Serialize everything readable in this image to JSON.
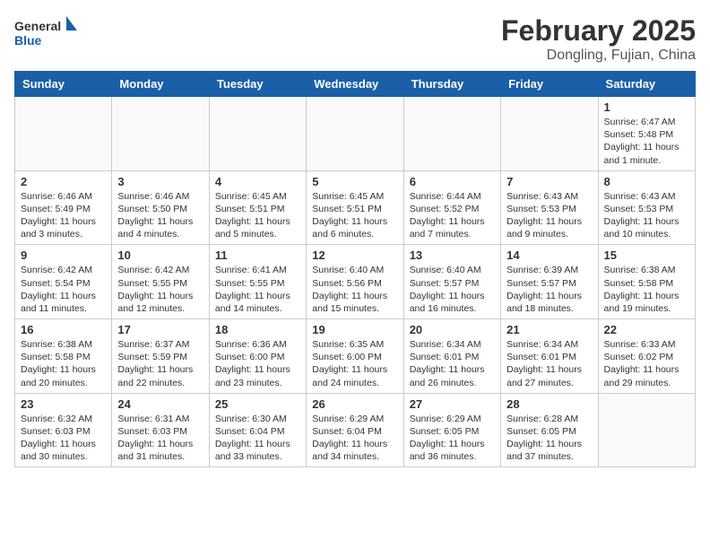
{
  "header": {
    "logo_general": "General",
    "logo_blue": "Blue",
    "title": "February 2025",
    "subtitle": "Dongling, Fujian, China"
  },
  "days_of_week": [
    "Sunday",
    "Monday",
    "Tuesday",
    "Wednesday",
    "Thursday",
    "Friday",
    "Saturday"
  ],
  "weeks": [
    [
      {
        "day": "",
        "info": ""
      },
      {
        "day": "",
        "info": ""
      },
      {
        "day": "",
        "info": ""
      },
      {
        "day": "",
        "info": ""
      },
      {
        "day": "",
        "info": ""
      },
      {
        "day": "",
        "info": ""
      },
      {
        "day": "1",
        "info": "Sunrise: 6:47 AM\nSunset: 5:48 PM\nDaylight: 11 hours\nand 1 minute."
      }
    ],
    [
      {
        "day": "2",
        "info": "Sunrise: 6:46 AM\nSunset: 5:49 PM\nDaylight: 11 hours\nand 3 minutes."
      },
      {
        "day": "3",
        "info": "Sunrise: 6:46 AM\nSunset: 5:50 PM\nDaylight: 11 hours\nand 4 minutes."
      },
      {
        "day": "4",
        "info": "Sunrise: 6:45 AM\nSunset: 5:51 PM\nDaylight: 11 hours\nand 5 minutes."
      },
      {
        "day": "5",
        "info": "Sunrise: 6:45 AM\nSunset: 5:51 PM\nDaylight: 11 hours\nand 6 minutes."
      },
      {
        "day": "6",
        "info": "Sunrise: 6:44 AM\nSunset: 5:52 PM\nDaylight: 11 hours\nand 7 minutes."
      },
      {
        "day": "7",
        "info": "Sunrise: 6:43 AM\nSunset: 5:53 PM\nDaylight: 11 hours\nand 9 minutes."
      },
      {
        "day": "8",
        "info": "Sunrise: 6:43 AM\nSunset: 5:53 PM\nDaylight: 11 hours\nand 10 minutes."
      }
    ],
    [
      {
        "day": "9",
        "info": "Sunrise: 6:42 AM\nSunset: 5:54 PM\nDaylight: 11 hours\nand 11 minutes."
      },
      {
        "day": "10",
        "info": "Sunrise: 6:42 AM\nSunset: 5:55 PM\nDaylight: 11 hours\nand 12 minutes."
      },
      {
        "day": "11",
        "info": "Sunrise: 6:41 AM\nSunset: 5:55 PM\nDaylight: 11 hours\nand 14 minutes."
      },
      {
        "day": "12",
        "info": "Sunrise: 6:40 AM\nSunset: 5:56 PM\nDaylight: 11 hours\nand 15 minutes."
      },
      {
        "day": "13",
        "info": "Sunrise: 6:40 AM\nSunset: 5:57 PM\nDaylight: 11 hours\nand 16 minutes."
      },
      {
        "day": "14",
        "info": "Sunrise: 6:39 AM\nSunset: 5:57 PM\nDaylight: 11 hours\nand 18 minutes."
      },
      {
        "day": "15",
        "info": "Sunrise: 6:38 AM\nSunset: 5:58 PM\nDaylight: 11 hours\nand 19 minutes."
      }
    ],
    [
      {
        "day": "16",
        "info": "Sunrise: 6:38 AM\nSunset: 5:58 PM\nDaylight: 11 hours\nand 20 minutes."
      },
      {
        "day": "17",
        "info": "Sunrise: 6:37 AM\nSunset: 5:59 PM\nDaylight: 11 hours\nand 22 minutes."
      },
      {
        "day": "18",
        "info": "Sunrise: 6:36 AM\nSunset: 6:00 PM\nDaylight: 11 hours\nand 23 minutes."
      },
      {
        "day": "19",
        "info": "Sunrise: 6:35 AM\nSunset: 6:00 PM\nDaylight: 11 hours\nand 24 minutes."
      },
      {
        "day": "20",
        "info": "Sunrise: 6:34 AM\nSunset: 6:01 PM\nDaylight: 11 hours\nand 26 minutes."
      },
      {
        "day": "21",
        "info": "Sunrise: 6:34 AM\nSunset: 6:01 PM\nDaylight: 11 hours\nand 27 minutes."
      },
      {
        "day": "22",
        "info": "Sunrise: 6:33 AM\nSunset: 6:02 PM\nDaylight: 11 hours\nand 29 minutes."
      }
    ],
    [
      {
        "day": "23",
        "info": "Sunrise: 6:32 AM\nSunset: 6:03 PM\nDaylight: 11 hours\nand 30 minutes."
      },
      {
        "day": "24",
        "info": "Sunrise: 6:31 AM\nSunset: 6:03 PM\nDaylight: 11 hours\nand 31 minutes."
      },
      {
        "day": "25",
        "info": "Sunrise: 6:30 AM\nSunset: 6:04 PM\nDaylight: 11 hours\nand 33 minutes."
      },
      {
        "day": "26",
        "info": "Sunrise: 6:29 AM\nSunset: 6:04 PM\nDaylight: 11 hours\nand 34 minutes."
      },
      {
        "day": "27",
        "info": "Sunrise: 6:29 AM\nSunset: 6:05 PM\nDaylight: 11 hours\nand 36 minutes."
      },
      {
        "day": "28",
        "info": "Sunrise: 6:28 AM\nSunset: 6:05 PM\nDaylight: 11 hours\nand 37 minutes."
      },
      {
        "day": "",
        "info": ""
      }
    ]
  ]
}
